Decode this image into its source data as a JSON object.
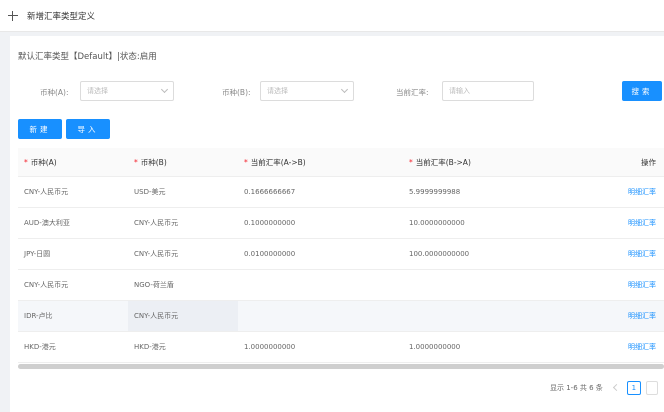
{
  "header": {
    "title": "新增汇率类型定义"
  },
  "subtitle": "默认汇率类型【Default】|状态:启用",
  "filters": {
    "source_label": "币种(A):",
    "source_placeholder": "请选择",
    "target_label": "币种(B):",
    "target_placeholder": "请选择",
    "rate_label": "当前汇率:",
    "rate_placeholder": "请输入",
    "search_label": "搜索"
  },
  "toolbar": {
    "new_label": "新建",
    "import_label": "导入"
  },
  "table": {
    "columns": [
      "币种(A)",
      "币种(B)",
      "当前汇率(A->B)",
      "当前汇率(B->A)",
      "操作"
    ],
    "rows": [
      {
        "a": "CNY-人民币元",
        "b": "USD-美元",
        "ab": "0.1666666667",
        "ba": "5.9999999988",
        "action": "明细汇率"
      },
      {
        "a": "AUD-澳大利亚",
        "b": "CNY-人民币元",
        "ab": "0.1000000000",
        "ba": "10.0000000000",
        "action": "明细汇率"
      },
      {
        "a": "JPY-日圆",
        "b": "CNY-人民币元",
        "ab": "0.0100000000",
        "ba": "100.0000000000",
        "action": "明细汇率"
      },
      {
        "a": "CNY-人民币元",
        "b": "NGO-荷兰盾",
        "ab": "",
        "ba": "",
        "action": "明细汇率"
      },
      {
        "a": "IDR-卢比",
        "b": "CNY-人民币元",
        "ab": "",
        "ba": "",
        "action": "明细汇率"
      },
      {
        "a": "HKD-港元",
        "b": "HKD-港元",
        "ab": "1.0000000000",
        "ba": "1.0000000000",
        "action": "明细汇率"
      }
    ]
  },
  "pagination": {
    "info": "显示 1-6 共 6 条",
    "current_page": "1"
  },
  "colors": {
    "primary": "#1890ff",
    "required": "#f5222d"
  },
  "icons": {
    "back": "plus-icon",
    "dropdown": "chevron-down-icon"
  }
}
